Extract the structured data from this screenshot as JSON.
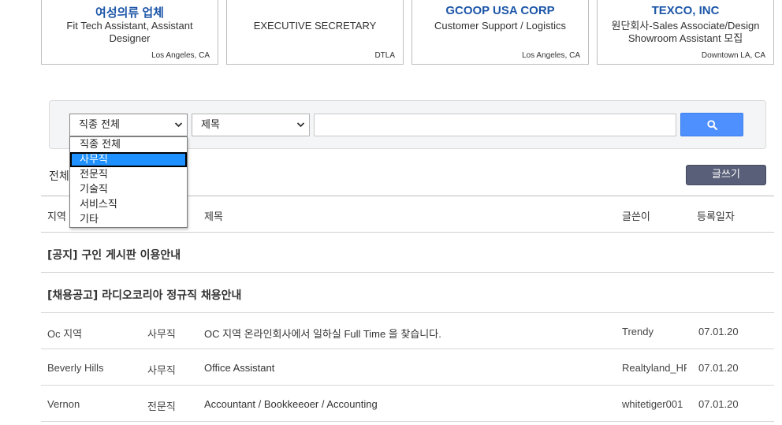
{
  "companies": [
    {
      "name": "여성의류 업체",
      "title": "Fit Tech Assistant, Assistant Designer",
      "location": "Los Angeles, CA"
    },
    {
      "name": "",
      "title": "EXECUTIVE SECRETARY",
      "location": "DTLA"
    },
    {
      "name": "GCOOP USA CORP",
      "title": "Customer Support / Logistics",
      "location": "Los Angeles, CA"
    },
    {
      "name": "TEXCO, INC",
      "title": "원단회사-Sales Associate/Design Showroom Assistant 모집",
      "location": "Downtown LA, CA"
    }
  ],
  "search": {
    "category_selected": "직종 전체",
    "field_selected": "제목",
    "query": "",
    "category_options": [
      "직종 전체",
      "사무직",
      "전문직",
      "기술직",
      "서비스직",
      "기타"
    ],
    "highlighted_option": "사무직"
  },
  "list": {
    "total_label": "전체",
    "write_label": "글쓰기",
    "headers": {
      "region": "지역",
      "title": "제목",
      "author": "글쓴이",
      "date": "등록일자"
    },
    "notices": [
      "[공지] 구인 게시판 이용안내",
      "[채용공고] 라디오코리아 정규직 채용안내"
    ],
    "posts": [
      {
        "region": "Oc 지역",
        "category": "사무직",
        "title": "OC 지역 온라인회사에서 일하실 Full Time 을 찾습니다.",
        "author": "Trendy",
        "date": "07.01.20"
      },
      {
        "region": "Beverly Hills",
        "category": "사무직",
        "title": "Office Assistant",
        "author": "Realtyland_HR",
        "date": "07.01.20"
      },
      {
        "region": "Vernon",
        "category": "전문직",
        "title": "Accountant / Bookkeeoer / Accounting",
        "author": "whitetiger001",
        "date": "07.01.20"
      }
    ]
  },
  "colors": {
    "accent": "#4d90fe",
    "company_name": "#1d56a8",
    "write_button": "#595f78",
    "highlight": "#1e90ff"
  },
  "icons": {
    "search_button": "search-icon",
    "select_arrow": "chevron-down-icon"
  }
}
